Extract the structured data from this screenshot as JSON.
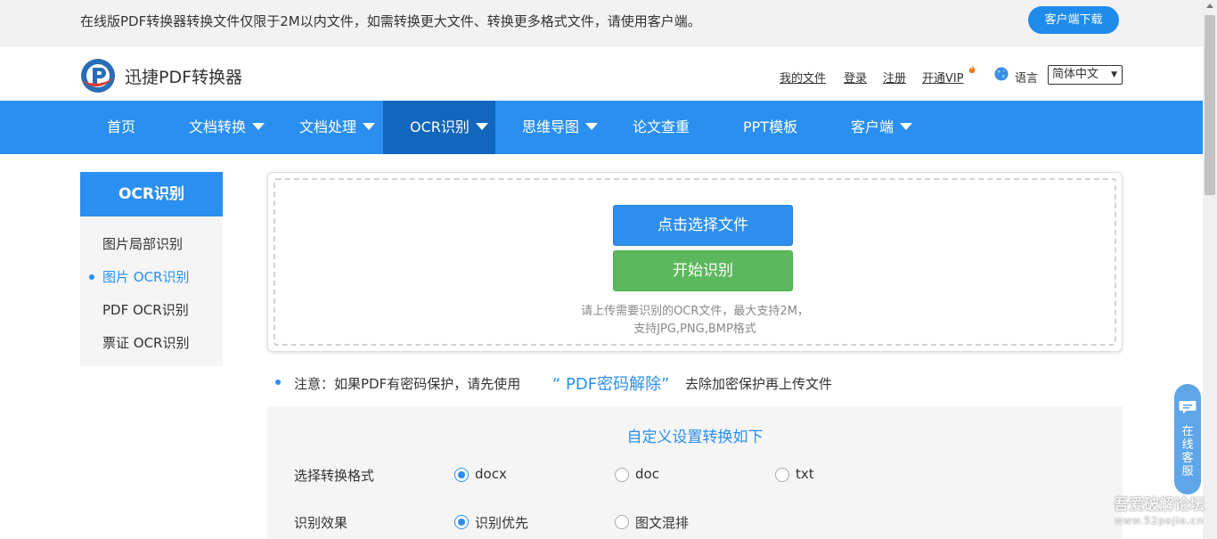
{
  "topbar": {
    "notice": "在线版PDF转换器转换文件仅限于2M以内文件，如需转换更大文件、转换更多格式文件，请使用客户端。",
    "download_button": "客户端下载"
  },
  "header": {
    "brand": "迅捷PDF转换器",
    "links": {
      "my_files": "我的文件",
      "login": "登录",
      "register": "注册",
      "vip": "开通VIP"
    },
    "language_label": "语言",
    "language_selected": "简体中文"
  },
  "nav": {
    "items": [
      {
        "label": "首页",
        "dropdown": false
      },
      {
        "label": "文档转换",
        "dropdown": true
      },
      {
        "label": "文档处理",
        "dropdown": true
      },
      {
        "label": "OCR识别",
        "dropdown": true,
        "active": true
      },
      {
        "label": "思维导图",
        "dropdown": true
      },
      {
        "label": "论文查重",
        "dropdown": false
      },
      {
        "label": "PPT模板",
        "dropdown": false
      },
      {
        "label": "客户端",
        "dropdown": true
      }
    ]
  },
  "sidebar": {
    "title": "OCR识别",
    "items": [
      {
        "label": "图片局部识别"
      },
      {
        "label": "图片 OCR识别",
        "active": true
      },
      {
        "label": "PDF OCR识别"
      },
      {
        "label": "票证 OCR识别"
      }
    ]
  },
  "upload": {
    "choose_button": "点击选择文件",
    "start_button": "开始识别",
    "hint_line1": "请上传需要识别的OCR文件，最大支持2M，",
    "hint_line2": "支持JPG,PNG,BMP格式"
  },
  "note": {
    "before": "注意：如果PDF有密码保护，请先使用",
    "link": "“ PDF密码解除”",
    "after": "去除加密保护再上传文件"
  },
  "settings": {
    "title": "自定义设置转换如下",
    "rows": [
      {
        "label": "选择转换格式",
        "options": [
          "docx",
          "doc",
          "txt"
        ],
        "selected": 0
      },
      {
        "label": "识别效果",
        "options": [
          "识别优先",
          "图文混排"
        ],
        "selected": 0
      }
    ]
  },
  "service": {
    "label": "在线客服"
  },
  "watermark": {
    "line1": "吾爱破解论坛",
    "line2": "www.52pojie.cn"
  },
  "colors": {
    "primary": "#2a8ff0",
    "nav_active": "#1366bd",
    "start_green": "#5cb85c"
  }
}
